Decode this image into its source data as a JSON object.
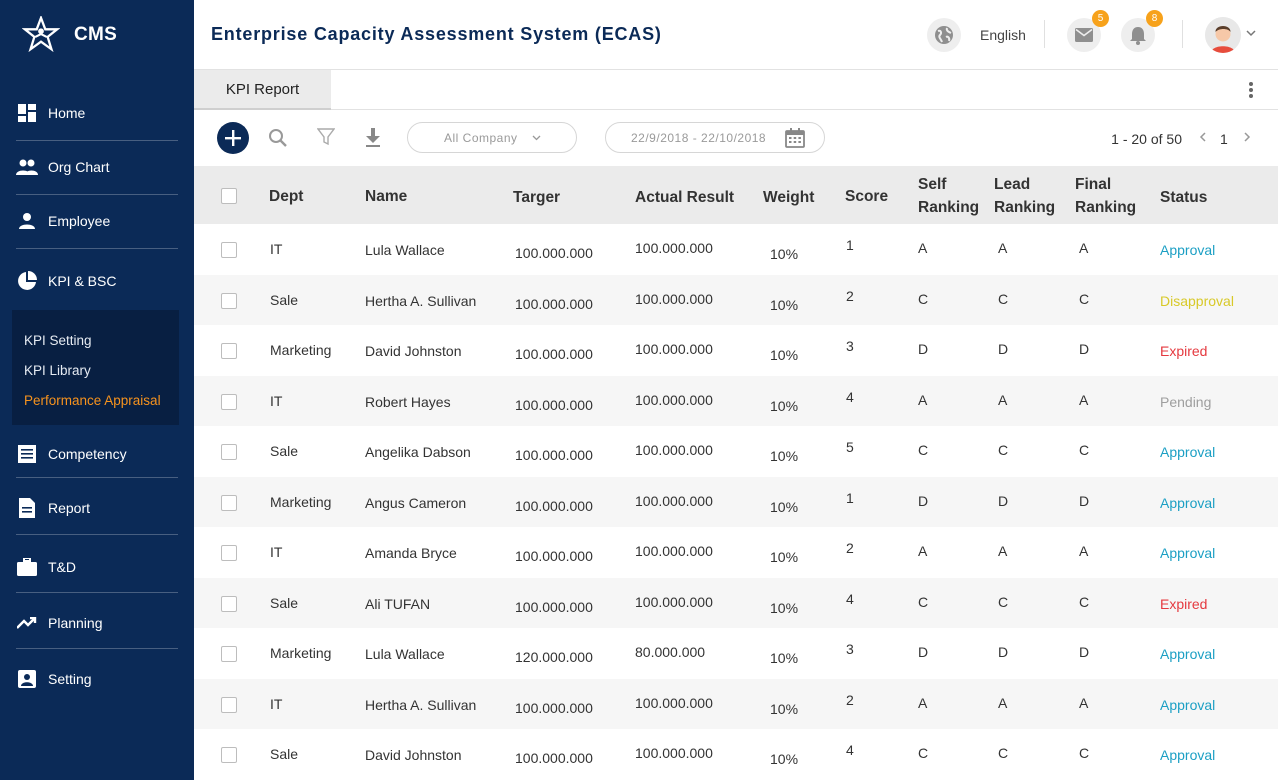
{
  "brand": {
    "name": "CMS"
  },
  "sidebar": {
    "items": [
      {
        "label": "Home",
        "icon": "dashboard-icon"
      },
      {
        "label": "Org Chart",
        "icon": "people-icon"
      },
      {
        "label": "Employee",
        "icon": "person-icon"
      },
      {
        "label": "KPI & BSC",
        "icon": "pie-chart-icon"
      },
      {
        "label": "Competency",
        "icon": "list-icon"
      },
      {
        "label": "Report",
        "icon": "document-icon"
      },
      {
        "label": "T&D",
        "icon": "briefcase-icon"
      },
      {
        "label": "Planning",
        "icon": "trending-icon"
      },
      {
        "label": "Setting",
        "icon": "account-box-icon"
      }
    ],
    "submenu": [
      {
        "label": "KPI Setting",
        "active": false
      },
      {
        "label": "KPI Library",
        "active": false
      },
      {
        "label": "Performance Appraisal",
        "active": true
      }
    ]
  },
  "header": {
    "title": "Enterprise Capacity Assessment System (ECAS)",
    "language": "English",
    "mail_count": "5",
    "notification_count": "8"
  },
  "tabs": [
    {
      "label": "KPI Report"
    }
  ],
  "toolbar": {
    "company_filter": "All Company",
    "date_range": "22/9/2018 - 22/10/2018",
    "pagination": {
      "range": "1 - 20 of 50",
      "page": "1"
    }
  },
  "table": {
    "columns": {
      "dept": "Dept",
      "name": "Name",
      "target": "Targer",
      "actual": "Actual Result",
      "weight": "Weight",
      "score": "Score",
      "self_1": "Self",
      "self_2": "Ranking",
      "lead_1": "Lead",
      "lead_2": "Ranking",
      "final_1": "Final",
      "final_2": "Ranking",
      "status": "Status"
    },
    "rows": [
      {
        "dept": "IT",
        "name": "Lula Wallace",
        "target": "100.000.000",
        "actual": "100.000.000",
        "weight": "10%",
        "score": "1",
        "self": "A",
        "lead": "A",
        "final": "A",
        "status": "Approval"
      },
      {
        "dept": "Sale",
        "name": "Hertha A. Sullivan",
        "target": "100.000.000",
        "actual": "100.000.000",
        "weight": "10%",
        "score": "2",
        "self": "C",
        "lead": "C",
        "final": "C",
        "status": "Disapproval"
      },
      {
        "dept": "Marketing",
        "name": "David Johnston",
        "target": "100.000.000",
        "actual": "100.000.000",
        "weight": "10%",
        "score": "3",
        "self": "D",
        "lead": "D",
        "final": "D",
        "status": "Expired"
      },
      {
        "dept": "IT",
        "name": "Robert Hayes",
        "target": "100.000.000",
        "actual": "100.000.000",
        "weight": "10%",
        "score": "4",
        "self": "A",
        "lead": "A",
        "final": "A",
        "status": "Pending"
      },
      {
        "dept": "Sale",
        "name": "Angelika Dabson",
        "target": "100.000.000",
        "actual": "100.000.000",
        "weight": "10%",
        "score": "5",
        "self": "C",
        "lead": "C",
        "final": "C",
        "status": "Approval"
      },
      {
        "dept": "Marketing",
        "name": "Angus Cameron",
        "target": "100.000.000",
        "actual": "100.000.000",
        "weight": "10%",
        "score": "1",
        "self": "D",
        "lead": "D",
        "final": "D",
        "status": "Approval"
      },
      {
        "dept": "IT",
        "name": "Amanda Bryce",
        "target": "100.000.000",
        "actual": "100.000.000",
        "weight": "10%",
        "score": "2",
        "self": "A",
        "lead": "A",
        "final": "A",
        "status": "Approval"
      },
      {
        "dept": "Sale",
        "name": "Ali TUFAN",
        "target": "100.000.000",
        "actual": "100.000.000",
        "weight": "10%",
        "score": "4",
        "self": "C",
        "lead": "C",
        "final": "C",
        "status": "Expired"
      },
      {
        "dept": "Marketing",
        "name": "Lula Wallace",
        "target": "120.000.000",
        "actual": "80.000.000",
        "weight": "10%",
        "score": "3",
        "self": "D",
        "lead": "D",
        "final": "D",
        "status": "Approval"
      },
      {
        "dept": "IT",
        "name": "Hertha A. Sullivan",
        "target": "100.000.000",
        "actual": "100.000.000",
        "weight": "10%",
        "score": "2",
        "self": "A",
        "lead": "A",
        "final": "A",
        "status": "Approval"
      },
      {
        "dept": "Sale",
        "name": "David Johnston",
        "target": "100.000.000",
        "actual": "100.000.000",
        "weight": "10%",
        "score": "4",
        "self": "C",
        "lead": "C",
        "final": "C",
        "status": "Approval"
      }
    ]
  },
  "colors": {
    "sidebar_bg": "#0b2a57",
    "active_submenu": "#f7931e",
    "approval": "#1b9fc4",
    "disapproval": "#d8c928",
    "expired": "#e5393f",
    "pending": "#9e9e9e",
    "badge": "#f7a21b"
  }
}
